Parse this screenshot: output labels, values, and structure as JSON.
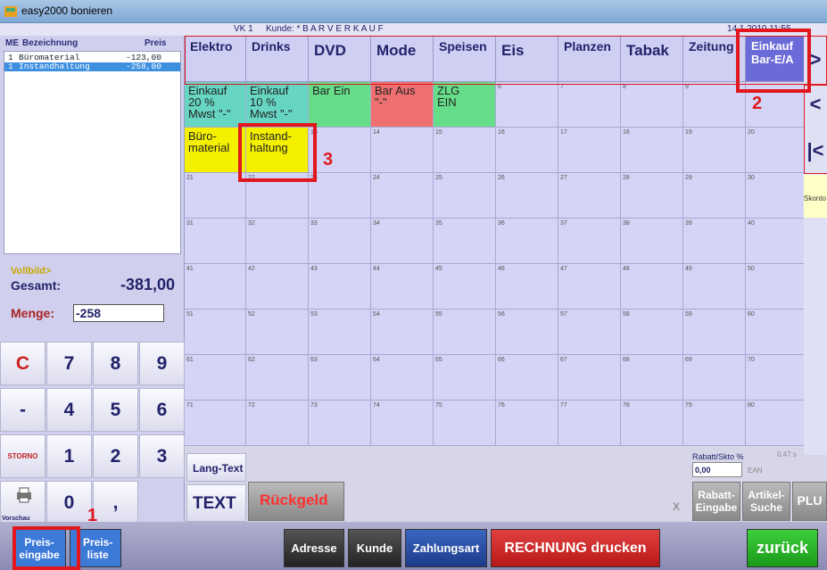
{
  "window": {
    "title": "easy2000 bonieren"
  },
  "header": {
    "vk": "VK 1",
    "kunde": "Kunde: * B A R V E R K A U F",
    "date": "14.1.2010 11:55"
  },
  "list": {
    "col_me": "ME",
    "col_bez": "Bezeichnung",
    "col_preis": "Preis",
    "rows": [
      {
        "me": "1",
        "bez": "Büromaterial",
        "preis": "-123,00",
        "selected": false
      },
      {
        "me": "1",
        "bez": "Instandhaltung",
        "preis": "-258,00",
        "selected": true
      }
    ]
  },
  "summary": {
    "vollbild": "Vollbild>",
    "gesamt_label": "Gesamt:",
    "gesamt_value": "-381,00",
    "menge_label": "Menge:",
    "menge_value": "-258"
  },
  "keypad": {
    "keys": [
      "C",
      "7",
      "8",
      "9",
      "-",
      "4",
      "5",
      "6",
      "STORNO",
      "1",
      "2",
      "3",
      "Vorschau",
      "0",
      ","
    ]
  },
  "categories": [
    "Elektro",
    "Drinks",
    "DVD",
    "Mode",
    "Speisen",
    "Eis",
    "Planzen",
    "Tabak",
    "Zeitung",
    "Einkauf\nBar-E/A"
  ],
  "cells": [
    {
      "n": "",
      "label": "Einkauf\n20 %\nMwst \"-\"",
      "color": "teal"
    },
    {
      "n": "",
      "label": "Einkauf\n10 %\nMwst \"-\"",
      "color": "teal"
    },
    {
      "n": "",
      "label": "Bar Ein",
      "color": "green"
    },
    {
      "n": "",
      "label": "Bar Aus\n\"-\"",
      "color": "salmon"
    },
    {
      "n": "",
      "label": "ZLG\nEIN",
      "color": "green"
    },
    {
      "n": "6",
      "label": "",
      "color": ""
    },
    {
      "n": "7",
      "label": "",
      "color": ""
    },
    {
      "n": "8",
      "label": "",
      "color": ""
    },
    {
      "n": "9",
      "label": "",
      "color": ""
    },
    {
      "n": "",
      "label": "",
      "color": ""
    },
    {
      "n": "",
      "label": "Büro-\nmaterial",
      "color": "yellow"
    },
    {
      "n": "",
      "label": "Instand-\nhaltung",
      "color": "yellow"
    },
    {
      "n": "13",
      "label": "",
      "color": ""
    },
    {
      "n": "14",
      "label": "",
      "color": ""
    },
    {
      "n": "15",
      "label": "",
      "color": ""
    },
    {
      "n": "16",
      "label": "",
      "color": ""
    },
    {
      "n": "17",
      "label": "",
      "color": ""
    },
    {
      "n": "18",
      "label": "",
      "color": ""
    },
    {
      "n": "19",
      "label": "",
      "color": ""
    },
    {
      "n": "20",
      "label": "",
      "color": ""
    }
  ],
  "nav": {
    "next": ">",
    "prev": "<",
    "first": "|<",
    "skonto": "Skonto"
  },
  "bottom_tools": {
    "langtext": "Lang-Text",
    "text": "TEXT",
    "rueckgeld": "Rückgeld",
    "rabatt_label": "Rabatt/Skto %",
    "rabatt_small": "0.47 s",
    "rabatt_value": "0,00",
    "ean": "EAN",
    "x": "X",
    "rabatt_eingabe": "Rabatt-\nEingabe",
    "artikel_suche": "Artikel-\nSuche",
    "plu": "PLU"
  },
  "footer": {
    "preis_eingabe": "Preis-\neingabe",
    "preis_liste": "Preis-\nliste",
    "adresse": "Adresse",
    "kunde": "Kunde",
    "zahlungsart": "Zahlungsart",
    "rechnung": "RECHNUNG drucken",
    "zurueck": "zurück"
  },
  "annotations": [
    "1",
    "2",
    "3"
  ],
  "colors": {
    "accent": "#e0181e",
    "green": "#66dd88",
    "teal": "#66d6c2",
    "salmon": "#ee7070",
    "yellow": "#f4f000"
  }
}
